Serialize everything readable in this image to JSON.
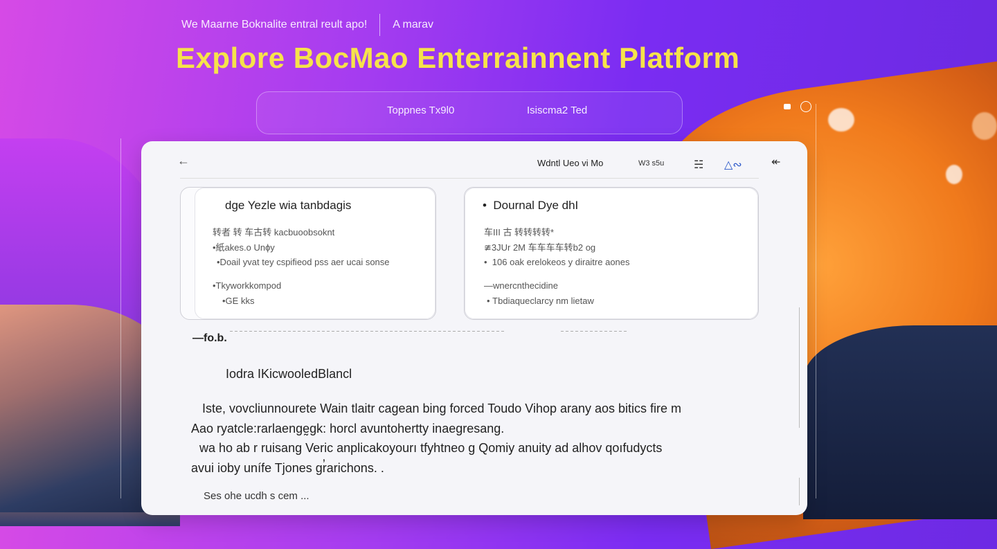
{
  "topbar": {
    "left_text": "We Maarne Boknalite entral reult apo!",
    "right_text": "A marav"
  },
  "hero": {
    "title": "Explore BocMao Enterrainnent Platform"
  },
  "subnav": {
    "item1": "Toppnes Tx9l0",
    "item2": "Isiscma2 Ted"
  },
  "card": {
    "header": {
      "back_icon": "arrow-left-icon",
      "meta": "Wdntl Ueo vi Mo",
      "tag": "W3 s5u",
      "icons": [
        "bookmark-icon",
        "share-icon",
        "collapse-icon"
      ]
    },
    "panel_left": {
      "title": "dge Yezle wia tanbdagis",
      "lines": [
        "转者 转 车古转 kacbuoobsoknt",
        "•紙akes.o Unɸy",
        "•Doail yvat tey cspifieod pss aer ucai sonse",
        "•Tkyworkkompod",
        "•GE kks"
      ]
    },
    "panel_right": {
      "title": "Dournal Dye dhI",
      "lines": [
        "车III 古 转转转转*",
        "≇3JUr 2M 车车车车转b2 og",
        "106 oak erelokeos y diraitre aones",
        "—wnercnthecidine",
        "Tbdiaqueclarcy nm lietaw"
      ]
    },
    "section_mark": "—fo.b.",
    "section_title": "Iodra IKicwooledBlancl",
    "paragraph": [
      "Iste, vovcliunnourete Wain tlaitr cagean bing forced Toudo Vihop arany aos bitics fire m",
      "Aao ryatcle:rarlaengḛgk: horcl avuntohertty inaegresang.",
      "wa ho ab r ruisang Veric anplicakoyourı tfyhtneo g Qomiy anuity ad alhov qoıfudycts",
      "avui ioby unífe Tjones gr̓arichons. ."
    ],
    "more": "Ses ohe ucdh s cem ..."
  }
}
